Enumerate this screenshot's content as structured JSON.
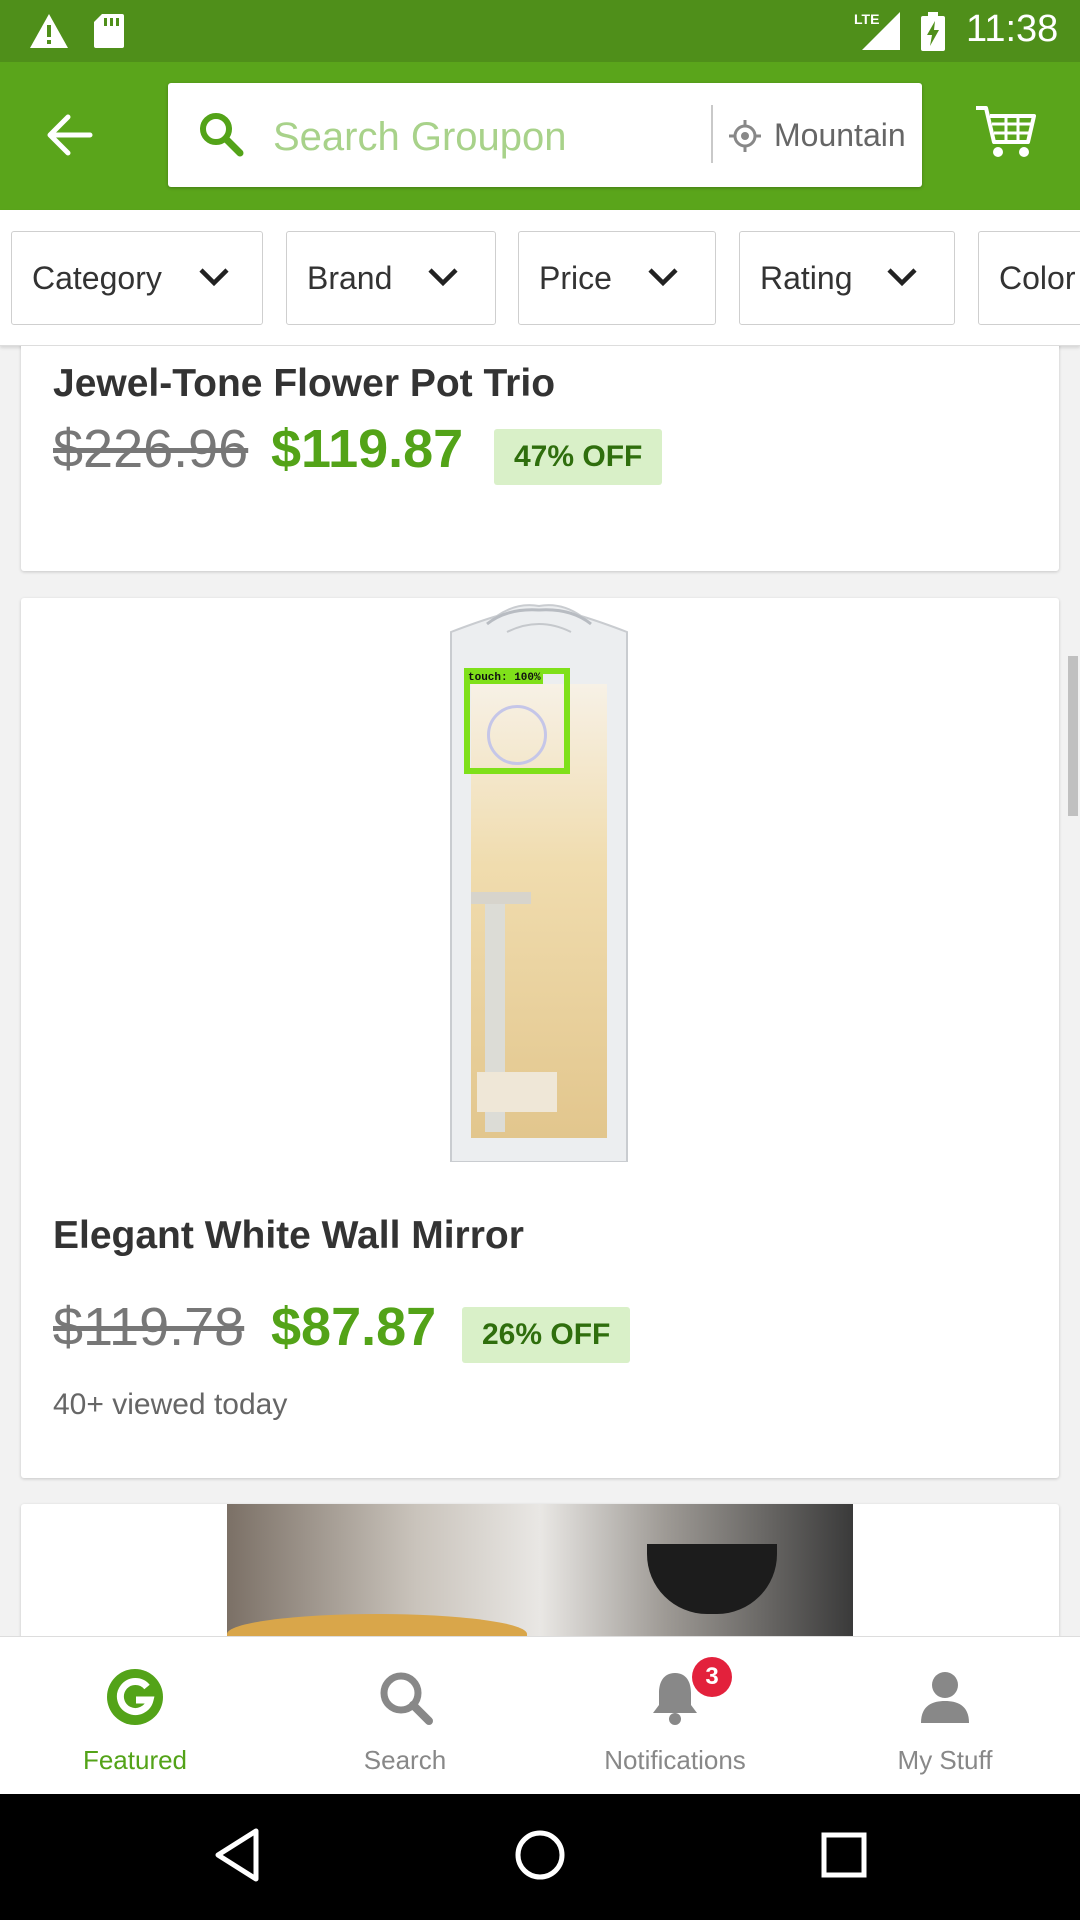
{
  "status_bar": {
    "time": "11:38",
    "network": "LTE"
  },
  "search": {
    "placeholder": "Search Groupon",
    "location": "Mountain View"
  },
  "filters": [
    "Category",
    "Brand",
    "Price",
    "Rating",
    "Color"
  ],
  "deals": [
    {
      "title": "Jewel-Tone Flower Pot Trio",
      "original_price": "$226.96",
      "price": "$119.87",
      "discount": "47% OFF"
    },
    {
      "title": "Elegant White Wall Mirror",
      "original_price": "$119.78",
      "price": "$87.87",
      "discount": "26% OFF",
      "viewed": "40+ viewed today",
      "overlay_label": "touch: 100%"
    }
  ],
  "bottom_nav": [
    {
      "label": "Featured",
      "icon": "groupon-g-icon",
      "active": true
    },
    {
      "label": "Search",
      "icon": "search-icon"
    },
    {
      "label": "Notifications",
      "icon": "bell-icon",
      "badge": "3"
    },
    {
      "label": "My Stuff",
      "icon": "person-icon"
    }
  ],
  "colors": {
    "status_bar": "#4f8f1a",
    "app_bar": "#5aa51b",
    "accent": "#53a318",
    "badge_bg": "#d9f0c8",
    "notif_badge": "#e3213c"
  }
}
